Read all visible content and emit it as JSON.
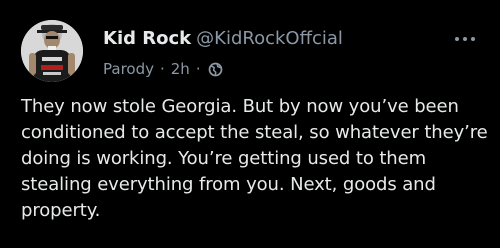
{
  "post": {
    "author": {
      "display_name": "Kid Rock",
      "handle": "@KidRockOffcial",
      "label": "Parody",
      "avatar_icon": "profile-photo"
    },
    "timestamp": "2h",
    "separator": "·",
    "visibility_icon": "globe-icon",
    "more_icon": "ellipsis-icon",
    "text": "They now stole Georgia. But by now you’ve been conditioned to accept the steal, so whatever they’re doing is working. You’re getting used to them stealing everything from you. Next, goods and property."
  },
  "colors": {
    "background": "#000000",
    "primary_text": "#e7e9ea",
    "secondary_text": "#8b98a5"
  }
}
